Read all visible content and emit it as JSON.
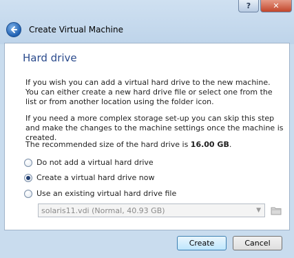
{
  "window": {
    "help_label": "?",
    "close_label": "✕",
    "title": "Create Virtual Machine"
  },
  "page": {
    "heading": "Hard drive",
    "paragraph1": "If you wish you can add a virtual hard drive to the new machine. You can either create a new hard drive file or select one from the list or from another location using the folder icon.",
    "paragraph2": "If you need a more complex storage set-up you can skip this step and make the changes to the machine settings once the machine is created.",
    "recommended_prefix": "The recommended size of the hard drive is ",
    "recommended_size": "16.00 GB",
    "recommended_suffix": "."
  },
  "options": {
    "do_not_add": "Do not add a virtual hard drive",
    "create_now": "Create a virtual hard drive now",
    "use_existing": "Use an existing virtual hard drive file",
    "selected": "create_now"
  },
  "existing_file": {
    "selected_value": "solaris11.vdi (Normal, 40.93 GB)"
  },
  "buttons": {
    "create": "Create",
    "cancel": "Cancel"
  },
  "icons": {
    "back": "back-arrow-icon",
    "folder": "folder-icon",
    "dropdown": "chevron-down-icon"
  }
}
